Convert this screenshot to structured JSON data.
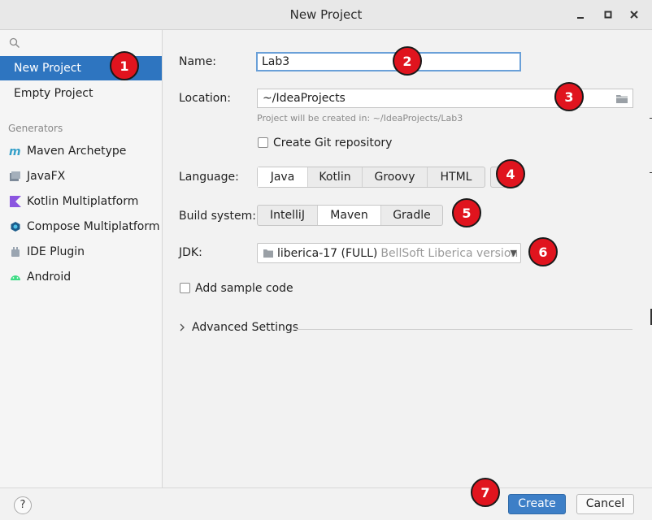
{
  "window": {
    "title": "New Project",
    "minimize": "‒",
    "maximize": "□",
    "close": "✕"
  },
  "sidebar": {
    "search_placeholder": "",
    "items": [
      {
        "label": "New Project",
        "selected": true
      },
      {
        "label": "Empty Project",
        "selected": false
      }
    ],
    "generators_label": "Generators",
    "generators": [
      {
        "label": "Maven Archetype",
        "icon": "maven-icon"
      },
      {
        "label": "JavaFX",
        "icon": "javafx-icon"
      },
      {
        "label": "Kotlin Multiplatform",
        "icon": "kotlin-icon"
      },
      {
        "label": "Compose Multiplatform",
        "icon": "compose-icon"
      },
      {
        "label": "IDE Plugin",
        "icon": "plugin-icon"
      },
      {
        "label": "Android",
        "icon": "android-icon"
      }
    ]
  },
  "form": {
    "name_label": "Name:",
    "name_value": "Lab3",
    "location_label": "Location:",
    "location_value": "~/IdeaProjects",
    "location_hint": "Project will be created in: ~/IdeaProjects/Lab3",
    "git_label": "Create Git repository",
    "language_label": "Language:",
    "languages": [
      "Java",
      "Kotlin",
      "Groovy",
      "HTML"
    ],
    "language_selected": "Java",
    "build_label": "Build system:",
    "build_systems": [
      "IntelliJ",
      "Maven",
      "Gradle"
    ],
    "build_selected": "Maven",
    "jdk_label": "JDK:",
    "jdk_value": "liberica-17 (FULL)",
    "jdk_detail": "BellSoft Liberica version",
    "sample_label": "Add sample code",
    "advanced_label": "Advanced Settings"
  },
  "footer": {
    "help_label": "?",
    "create_label": "Create",
    "cancel_label": "Cancel"
  },
  "markers": [
    "1",
    "2",
    "3",
    "4",
    "5",
    "6",
    "7"
  ],
  "colors": {
    "accent": "#2e75c0",
    "marker": "#e0141e",
    "primary_button": "#3d7fc7"
  }
}
